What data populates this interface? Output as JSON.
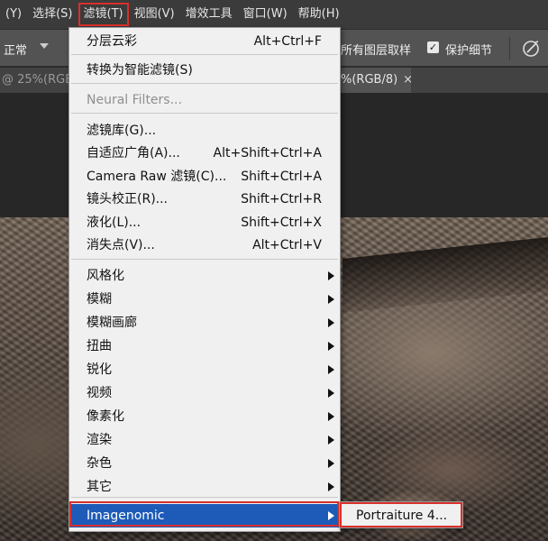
{
  "menubar": {
    "items": [
      "(Y)",
      "选择(S)",
      "滤镜(T)",
      "视图(V)",
      "增效工具",
      "窗口(W)",
      "帮助(H)"
    ],
    "active_index": 2
  },
  "options": {
    "mode_label": "正常",
    "sample_all_layers": "所有图层取样",
    "protect_detail": "保护细节",
    "protect_checked": true,
    "checkmark": "✓"
  },
  "tabs": {
    "tab1": "@ 25%(RGB/8",
    "tab2": "%(RGB/8)",
    "close_glyph": "×"
  },
  "filter_menu": {
    "items": [
      {
        "label": "分层云彩",
        "shortcut": "Alt+Ctrl+F"
      },
      {
        "label": "转换为智能滤镜(S)",
        "shortcut": ""
      },
      {
        "label": "Neural Filters...",
        "shortcut": "",
        "disabled": true
      },
      {
        "label": "滤镜库(G)...",
        "shortcut": ""
      },
      {
        "label": "自适应广角(A)...",
        "shortcut": "Alt+Shift+Ctrl+A"
      },
      {
        "label": "Camera Raw 滤镜(C)...",
        "shortcut": "Shift+Ctrl+A"
      },
      {
        "label": "镜头校正(R)...",
        "shortcut": "Shift+Ctrl+R"
      },
      {
        "label": "液化(L)...",
        "shortcut": "Shift+Ctrl+X"
      },
      {
        "label": "消失点(V)...",
        "shortcut": "Alt+Ctrl+V"
      },
      {
        "label": "风格化",
        "submenu": true
      },
      {
        "label": "模糊",
        "submenu": true
      },
      {
        "label": "模糊画廊",
        "submenu": true
      },
      {
        "label": "扭曲",
        "submenu": true
      },
      {
        "label": "锐化",
        "submenu": true
      },
      {
        "label": "视频",
        "submenu": true
      },
      {
        "label": "像素化",
        "submenu": true
      },
      {
        "label": "渲染",
        "submenu": true
      },
      {
        "label": "杂色",
        "submenu": true
      },
      {
        "label": "其它",
        "submenu": true
      },
      {
        "label": "Imagenomic",
        "submenu": true,
        "highlighted": true
      }
    ]
  },
  "submenu": {
    "items": [
      {
        "label": "Portraiture 4..."
      }
    ]
  },
  "colors": {
    "highlight": "#1e5bb8",
    "annotation_red": "#d8302b"
  }
}
